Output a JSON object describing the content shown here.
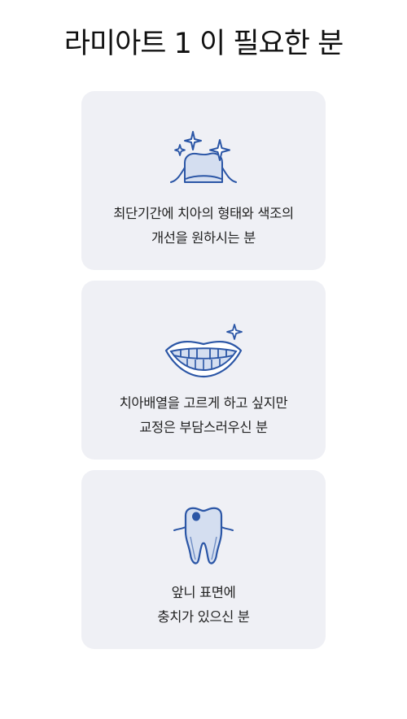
{
  "page": {
    "title": "라미아트 1 이 필요한 분"
  },
  "cards": [
    {
      "icon": "sparkling-tooth-icon",
      "lines": [
        "최단기간에 치아의 형태와 색조의",
        "개선을 원하시는 분"
      ]
    },
    {
      "icon": "smile-teeth-icon",
      "lines": [
        "치아배열을 고르게 하고 싶지만",
        "교정은 부담스러우신 분"
      ]
    },
    {
      "icon": "cavity-tooth-icon",
      "lines": [
        "앞니 표면에",
        "충치가 있으신 분"
      ]
    }
  ],
  "colors": {
    "background": "#ffffff",
    "card": "#eff0f5",
    "icon_stroke": "#2b56a6",
    "icon_fill": "#d4def0",
    "text": "#222222"
  }
}
